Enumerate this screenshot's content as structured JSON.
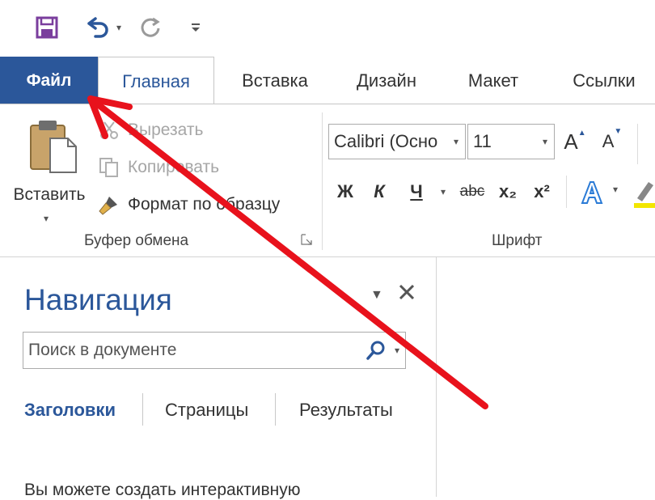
{
  "quick_access": {
    "save_icon": "save-icon",
    "undo_icon": "undo-icon",
    "redo_icon": "redo-icon",
    "customize_icon": "customize-qat-icon"
  },
  "tabs": [
    {
      "label": "Файл"
    },
    {
      "label": "Главная"
    },
    {
      "label": "Вставка"
    },
    {
      "label": "Дизайн"
    },
    {
      "label": "Макет"
    },
    {
      "label": "Ссылки"
    }
  ],
  "clipboard": {
    "paste_label": "Вставить",
    "cut_label": "Вырезать",
    "copy_label": "Копировать",
    "format_painter_label": "Формат по образцу",
    "group_label": "Буфер обмена"
  },
  "font": {
    "font_name": "Calibri (Осно",
    "font_size": "11",
    "group_label": "Шрифт",
    "bold": "Ж",
    "italic": "К",
    "underline": "Ч",
    "strike": "abc",
    "subscript": "x₂",
    "superscript": "x²",
    "grow": "A",
    "shrink": "A"
  },
  "navigation": {
    "title": "Навигация",
    "search_placeholder": "Поиск в документе",
    "tabs": [
      {
        "label": "Заголовки"
      },
      {
        "label": "Страницы"
      },
      {
        "label": "Результаты"
      }
    ],
    "info_text": "Вы можете создать интерактивную"
  },
  "colors": {
    "accent": "#2b579a",
    "arrow": "#e8121c"
  }
}
